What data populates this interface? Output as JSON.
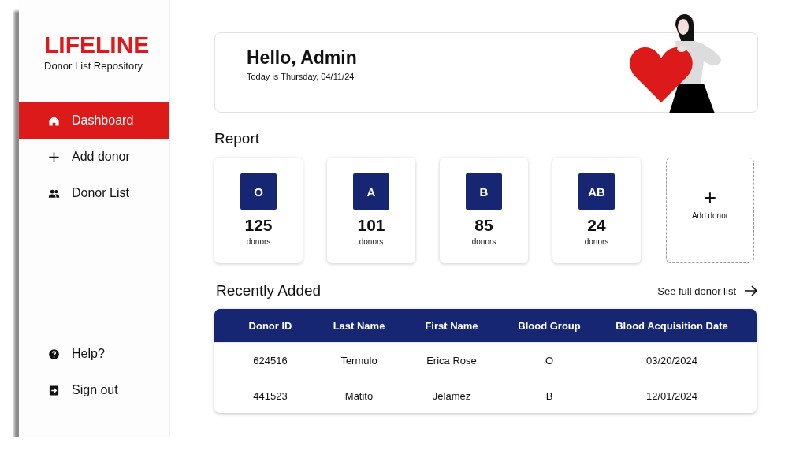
{
  "sidebar": {
    "logo": "LIFELINE",
    "subtitle": "Donor List Repository",
    "items": [
      {
        "label": "Dashboard",
        "kind": "home",
        "selected": true
      },
      {
        "label": "Add donor",
        "kind": "add",
        "selected": false
      },
      {
        "label": "Donor List",
        "kind": "list",
        "selected": false
      }
    ],
    "footer_items": [
      {
        "label": "Help?",
        "kind": "help"
      },
      {
        "label": "Sign out",
        "kind": "signout"
      }
    ]
  },
  "greeting": {
    "title": "Hello, Admin",
    "date": "Today is Thursday, 04/11/24"
  },
  "report": {
    "title": "Report",
    "cards": [
      {
        "group": "O",
        "count": "125",
        "unit": "donors"
      },
      {
        "group": "A",
        "count": "101",
        "unit": "donors"
      },
      {
        "group": "B",
        "count": "85",
        "unit": "donors"
      },
      {
        "group": "AB",
        "count": "24",
        "unit": "donors"
      }
    ],
    "add_card": {
      "icon": "+",
      "label": "Add donor"
    }
  },
  "recent": {
    "title": "Recently Added",
    "link": "See full donor list",
    "table": {
      "columns": [
        "Donor ID",
        "Last Name",
        "First Name",
        "Blood Group",
        "Blood Acquisition Date"
      ],
      "rows": [
        [
          "624516",
          "Termulo",
          "Erica Rose",
          "O",
          "03/20/2024"
        ],
        [
          "441523",
          "Matito",
          "Jelamez",
          "B",
          "12/01/2024"
        ]
      ]
    }
  }
}
